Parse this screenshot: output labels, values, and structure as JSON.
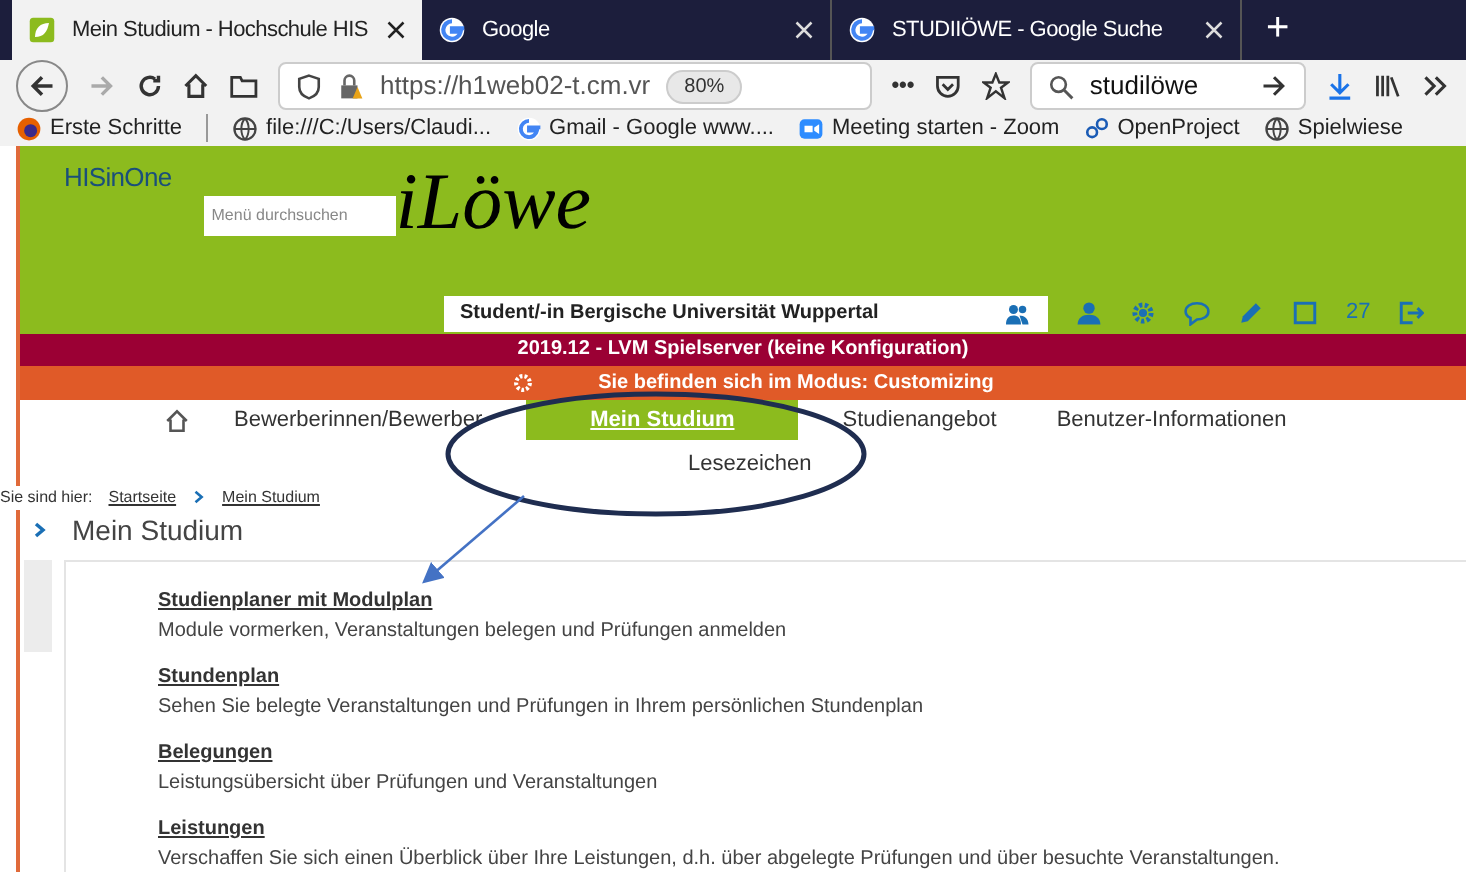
{
  "browser": {
    "tabs": [
      {
        "title": "Mein Studium - Hochschule HIS",
        "selected": true
      },
      {
        "title": "Google",
        "selected": false
      },
      {
        "title": "STUDIIÖWE - Google Suche",
        "selected": false
      }
    ],
    "new_tab": "+",
    "address": {
      "url": "https://h1web02-t.cm.vr",
      "zoom": "80%"
    },
    "overflow": "•••",
    "search": {
      "value": "studilöwe"
    },
    "bookmarks": [
      "Erste Schritte",
      "file:///C:/Users/Claudi...",
      "Gmail - Google  www....",
      "Meeting starten - Zoom",
      "OpenProject",
      "Spielwiese"
    ]
  },
  "page": {
    "brand": "HISinOne",
    "menu_search": {
      "placeholder": "Menü durchsuchen"
    },
    "logo": "iLöwe",
    "role": "Student/-in Bergische Universität Wuppertal",
    "count": "27",
    "server_banner": "2019.12 - LVM Spielserver (keine Konfiguration)",
    "mode_banner": "Sie befinden sich im Modus: Customizing",
    "nav": [
      {
        "label": "Bewerberinnen/Bewerber",
        "selected": false
      },
      {
        "label": "Mein Studium",
        "selected": true
      },
      {
        "label": "Studienangebot",
        "selected": false
      },
      {
        "label": "Benutzer-Informationen",
        "selected": false
      }
    ],
    "bookmarks_link": "Lesezeichen",
    "breadcrumb": {
      "label": "Sie sind hier:",
      "items": [
        "Startseite",
        "Mein Studium"
      ]
    },
    "heading": "Mein Studium",
    "entries": [
      {
        "title": "Studienplaner mit Modulplan",
        "description": "Module vormerken, Veranstaltungen belegen und Prüfungen anmelden"
      },
      {
        "title": "Stundenplan",
        "description": "Sehen Sie belegte Veranstaltungen und Prüfungen in Ihrem persönlichen Stundenplan"
      },
      {
        "title": "Belegungen",
        "description": "Leistungsübersicht über Prüfungen und Veranstaltungen"
      },
      {
        "title": "Leistungen",
        "description": "Verschaffen Sie sich einen Überblick über Ihre Leistungen, d.h. über abgelegte Prüfungen und über besuchte Veranstaltungen."
      }
    ]
  }
}
